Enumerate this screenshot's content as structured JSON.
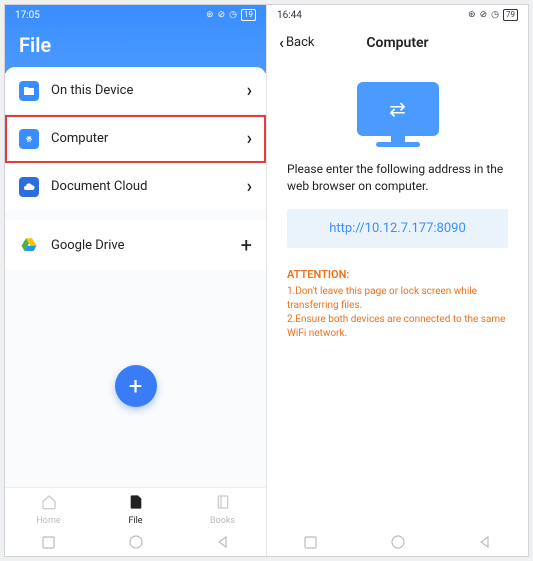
{
  "left": {
    "status": {
      "time": "17:05",
      "signal": "⁝₃ıl",
      "battery": "19"
    },
    "title": "File",
    "rows": [
      {
        "label": "On this Device",
        "action": "chevron",
        "icon": "folder",
        "color": "#3a8dff",
        "highlighted": false
      },
      {
        "label": "Computer",
        "action": "chevron",
        "icon": "computer",
        "color": "#3a8dff",
        "highlighted": true
      },
      {
        "label": "Document Cloud",
        "action": "chevron",
        "icon": "cloud",
        "color": "#2a6ee0",
        "highlighted": false
      }
    ],
    "drive_row": {
      "label": "Google Drive",
      "action": "plus",
      "icon": "drive"
    },
    "nav": [
      {
        "label": "Home",
        "icon": "home"
      },
      {
        "label": "File",
        "icon": "file"
      },
      {
        "label": "Books",
        "icon": "book"
      }
    ]
  },
  "right": {
    "status": {
      "time": "16:44",
      "signal": "⁝₃ıl ⁝",
      "battery": "79"
    },
    "back": "Back",
    "title": "Computer",
    "instructions": "Please enter the following address in the web browser on computer.",
    "url": "http://10.12.7.177:8090",
    "attention_title": "ATTENTION:",
    "attention_l1": "1.Don't leave this page or lock screen while transferring files.",
    "attention_l2": "2.Ensure both devices are connected to the same WiFi network."
  }
}
